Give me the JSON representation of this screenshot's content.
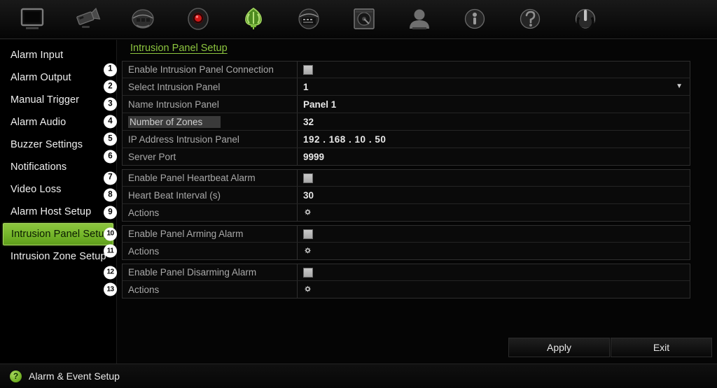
{
  "toolbar": {
    "items": [
      {
        "name": "display-icon",
        "label": "Display"
      },
      {
        "name": "camera-icon",
        "label": "Camera"
      },
      {
        "name": "network-icon",
        "label": "Network"
      },
      {
        "name": "record-icon",
        "label": "Record"
      },
      {
        "name": "alarm-bell-icon",
        "label": "Alarm",
        "active": true
      },
      {
        "name": "device-icon",
        "label": "Device"
      },
      {
        "name": "hard-disk-icon",
        "label": "Storage"
      },
      {
        "name": "user-icon",
        "label": "User"
      },
      {
        "name": "info-icon",
        "label": "Information"
      },
      {
        "name": "help-icon",
        "label": "Help"
      },
      {
        "name": "power-icon",
        "label": "Shutdown"
      }
    ]
  },
  "sidebar": {
    "items": [
      {
        "label": "Alarm Input",
        "active": false
      },
      {
        "label": "Alarm Output",
        "active": false
      },
      {
        "label": "Manual Trigger",
        "active": false
      },
      {
        "label": "Alarm Audio",
        "active": false
      },
      {
        "label": "Buzzer Settings",
        "active": false
      },
      {
        "label": "Notifications",
        "active": false
      },
      {
        "label": "Video Loss",
        "active": false
      },
      {
        "label": "Alarm Host Setup",
        "active": false
      },
      {
        "label": "Intrusion Panel Setup",
        "active": true
      },
      {
        "label": "Intrusion Zone Setup",
        "active": false
      }
    ]
  },
  "main": {
    "title": "Intrusion Panel Setup",
    "groups": [
      {
        "rows": [
          {
            "num": "1",
            "label": "Enable Intrusion Panel Connection",
            "value_type": "checkbox",
            "value": "",
            "checked": false
          },
          {
            "num": "2",
            "label": "Select Intrusion Panel",
            "value_type": "dropdown",
            "value": "1"
          },
          {
            "num": "3",
            "label": "Name Intrusion Panel",
            "value_type": "text",
            "value": "Panel 1"
          },
          {
            "num": "4",
            "label": "Number of Zones",
            "value_type": "text",
            "value": "32",
            "label_highlight": true
          },
          {
            "num": "5",
            "label": "IP Address Intrusion Panel",
            "value_type": "ip",
            "value": "192 . 168 . 10   . 50"
          },
          {
            "num": "6",
            "label": "Server Port",
            "value_type": "text",
            "value": "9999"
          }
        ]
      },
      {
        "rows": [
          {
            "num": "7",
            "label": "Enable Panel Heartbeat Alarm",
            "value_type": "checkbox",
            "value": "",
            "checked": false
          },
          {
            "num": "8",
            "label": "Heart Beat Interval (s)",
            "value_type": "text",
            "value": "30"
          },
          {
            "num": "9",
            "label": "Actions",
            "value_type": "gear",
            "value": ""
          }
        ]
      },
      {
        "rows": [
          {
            "num": "10",
            "label": "Enable Panel Arming Alarm",
            "value_type": "checkbox",
            "value": "",
            "checked": false
          },
          {
            "num": "11",
            "label": "Actions",
            "value_type": "gear",
            "value": ""
          }
        ]
      },
      {
        "rows": [
          {
            "num": "12",
            "label": "Enable Panel Disarming Alarm",
            "value_type": "checkbox",
            "value": "",
            "checked": false
          },
          {
            "num": "13",
            "label": "Actions",
            "value_type": "gear",
            "value": ""
          }
        ]
      }
    ]
  },
  "footer": {
    "apply_label": "Apply",
    "exit_label": "Exit"
  },
  "statusbar": {
    "icon": "help-circle-icon",
    "icon_glyph": "?",
    "text": "Alarm & Event Setup"
  },
  "colors": {
    "accent_green": "#8dc63f",
    "panel_bg": "#050505",
    "row_bg": "#0a0a0a",
    "label_text": "#a9a9a9",
    "value_text": "#e8e8e8"
  }
}
